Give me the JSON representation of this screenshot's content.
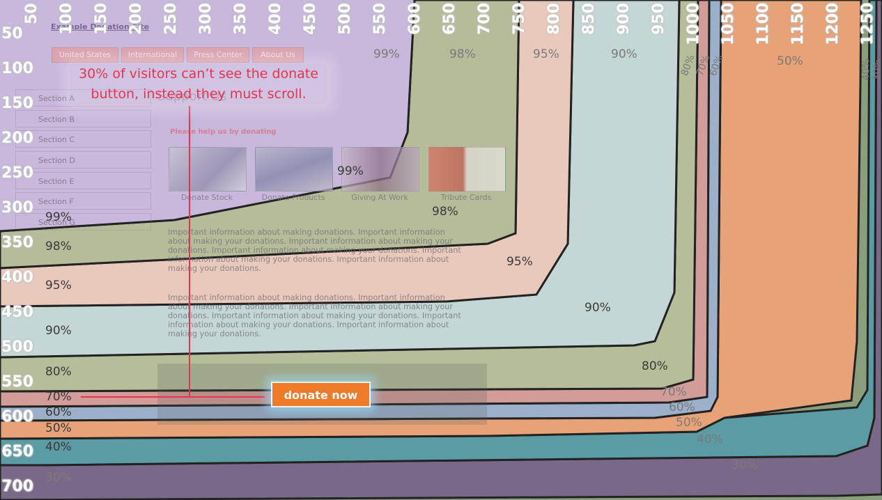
{
  "site": {
    "title": "Example Donation Site",
    "nav": [
      "United States",
      "International",
      "Press Center",
      "About Us"
    ],
    "sidebar": [
      "Section A",
      "Section B",
      "Section C",
      "Section D",
      "Section E",
      "Section F",
      "Section G"
    ],
    "heading": "Support Us",
    "help_text": "Please help us by donating",
    "tiles": [
      "Donate Stock",
      "Donate Products",
      "Giving At Work",
      "Tribute Cards"
    ],
    "paragraph1": "Important information about making donations. Important information about making your donations. Important information about making your donations. Important information about making your donations. Important information about making your donations. Important information about making your donations.",
    "paragraph2": "Important information about making donations. Important information about making your donations. Important information about making your donations. Important information about making your donations. Important information about making your donations. Important information about making your donations.",
    "donate_label": "donate now"
  },
  "annotation": {
    "callout": "30% of visitors can’t see the donate button, instead they must scroll."
  },
  "ruler": {
    "y_ticks": [
      "50",
      "100",
      "150",
      "200",
      "250",
      "300",
      "350",
      "400",
      "450",
      "500",
      "550",
      "600",
      "650",
      "700"
    ],
    "x_ticks": [
      "50",
      "100",
      "150",
      "200",
      "250",
      "300",
      "350",
      "400",
      "450",
      "500",
      "550",
      "600",
      "650",
      "700",
      "750",
      "800",
      "850",
      "900",
      "950",
      "1000",
      "1050",
      "1100",
      "1150",
      "1200",
      "1250"
    ]
  },
  "bands": [
    {
      "label": "99%",
      "color": "#c5bd9a"
    },
    {
      "label": "98%",
      "color": "#b6bc9a"
    },
    {
      "label": "95%",
      "color": "#e9c9bb"
    },
    {
      "label": "90%",
      "color": "#c5d6d6"
    },
    {
      "label": "80%",
      "color": "#b5bd99"
    },
    {
      "label": "70%",
      "color": "#d29c98"
    },
    {
      "label": "60%",
      "color": "#9db0c9"
    },
    {
      "label": "50%",
      "color": "#e7a277"
    },
    {
      "label": "40%",
      "color": "#5a9ba4"
    },
    {
      "label": "30%",
      "color": "#7a6888"
    }
  ],
  "band_labels": {
    "left": [
      "99%",
      "98%",
      "95%",
      "90%",
      "80%",
      "70%",
      "60%",
      "50%",
      "40%",
      "30%"
    ],
    "right": [
      "99%",
      "98%",
      "95%",
      "90%",
      "80%",
      "70%",
      "60%",
      "50%",
      "40%",
      "30%"
    ],
    "top": [
      "99%",
      "98%",
      "95%",
      "90%",
      "80%",
      "70%",
      "60%",
      "50%",
      "40%",
      "30%"
    ]
  },
  "colors": {
    "top_region": "#c7b8dc",
    "callout_text": "#e8334e",
    "donate_button": "#ee7a2a",
    "outline": "#222222"
  }
}
